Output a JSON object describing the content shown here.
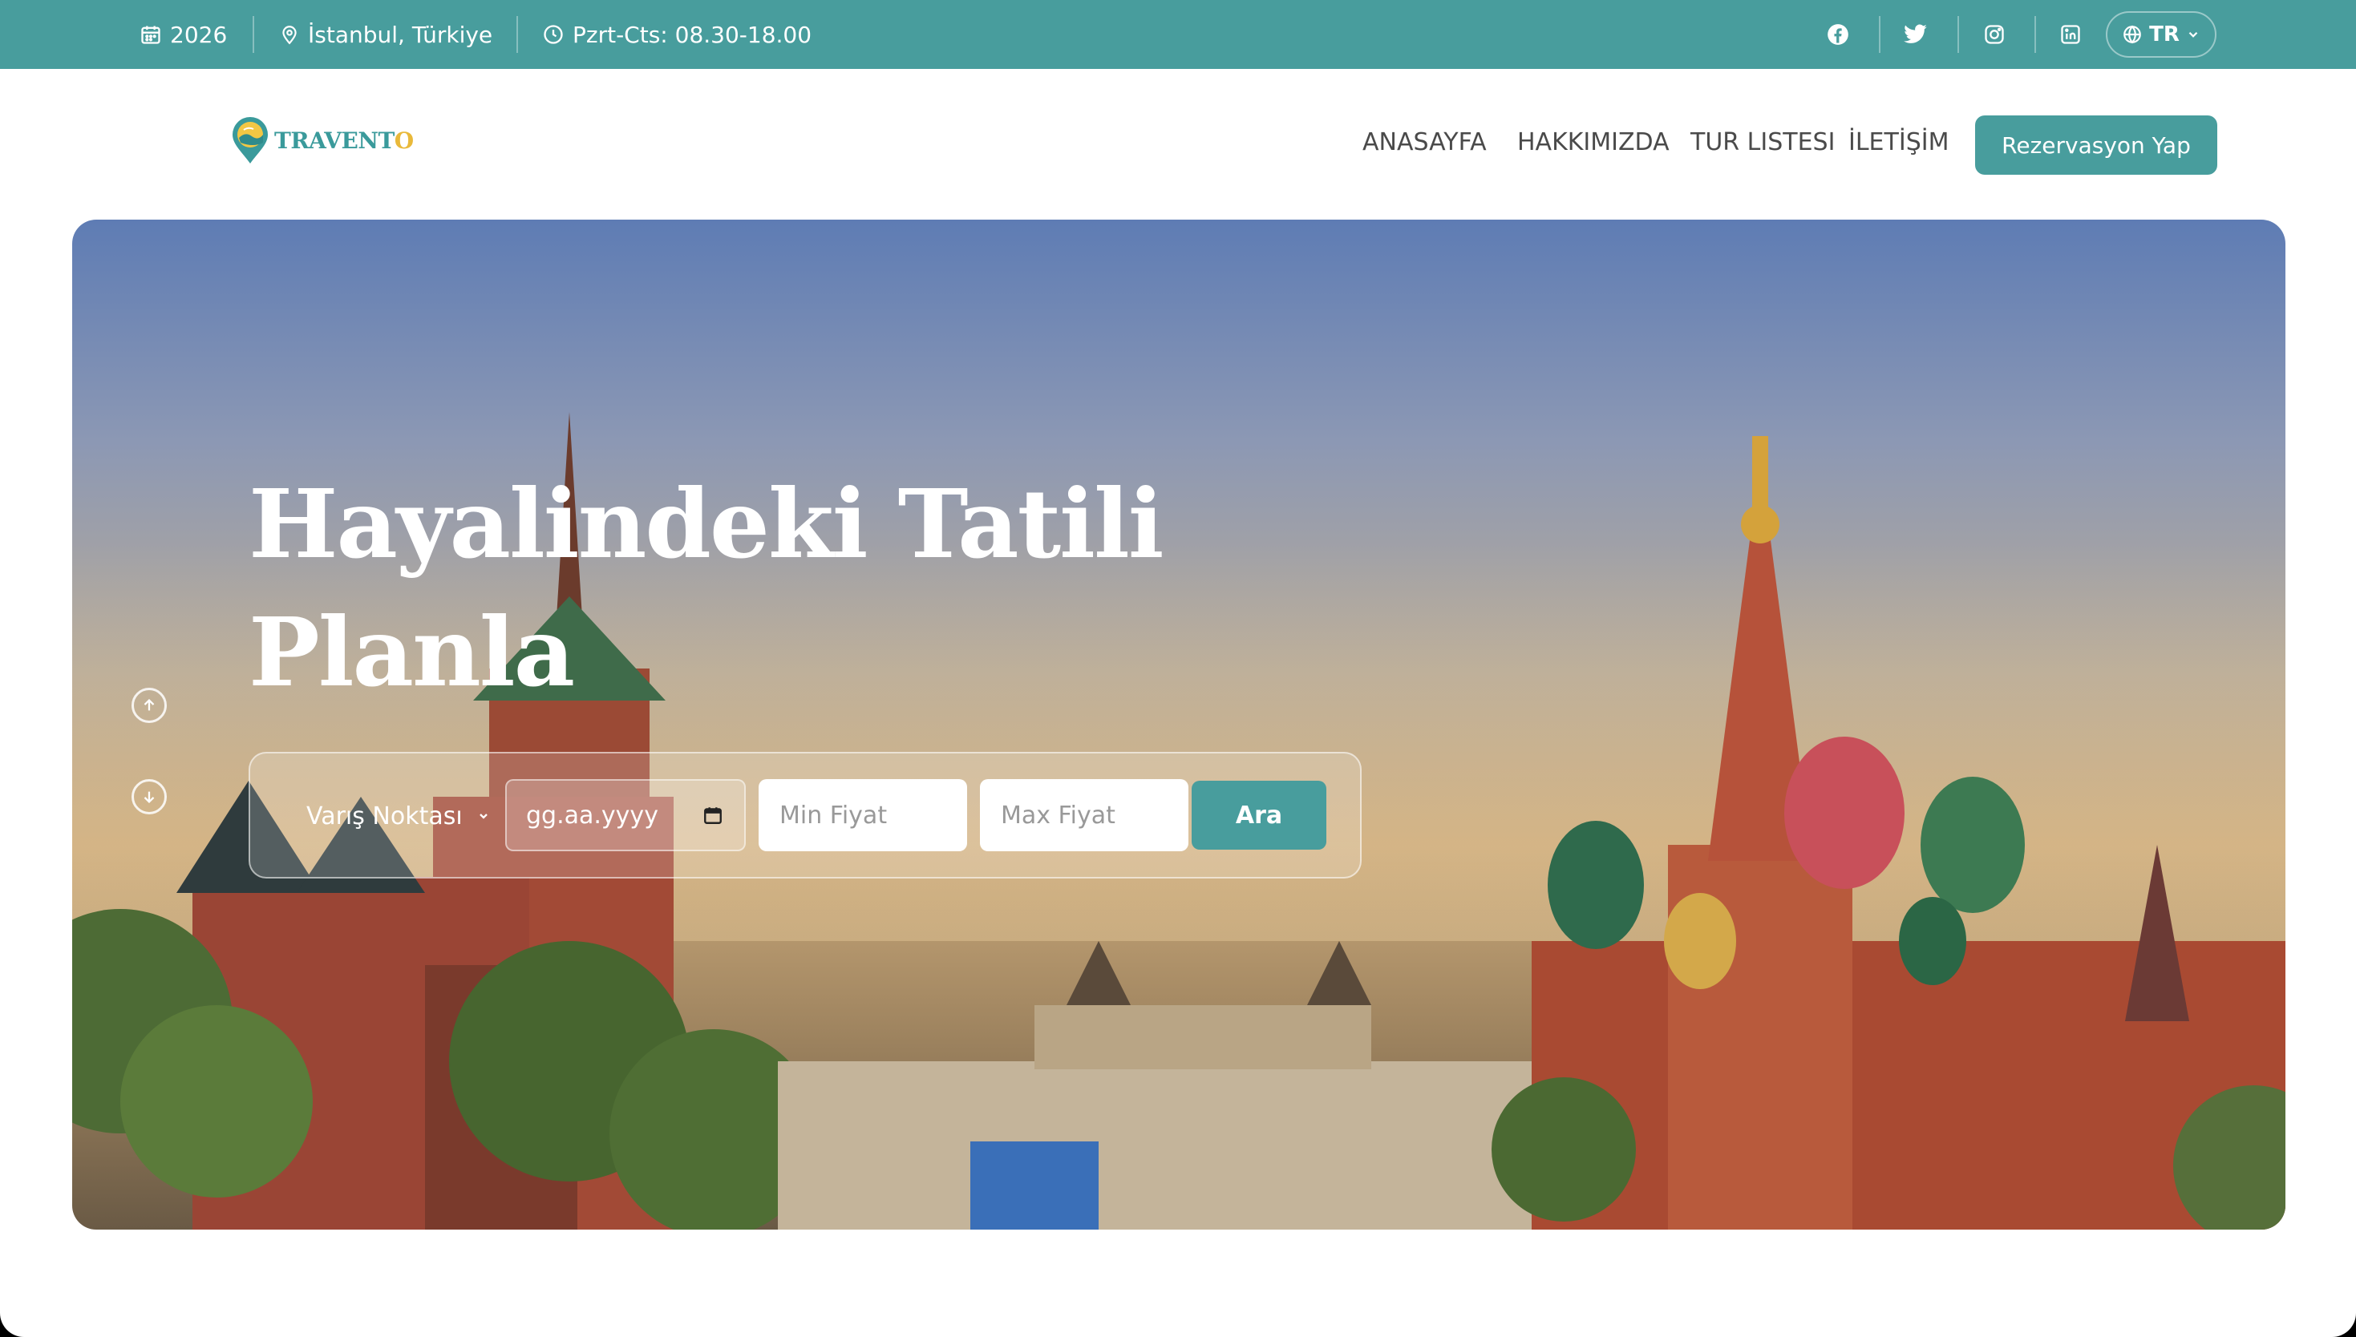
{
  "topbar": {
    "year": "2026",
    "location": "İstanbul, Türkiye",
    "hours": "Pzrt-Cts: 08.30-18.00",
    "social": [
      "facebook-icon",
      "twitter-icon",
      "instagram-icon",
      "linkedin-icon"
    ],
    "language": "TR"
  },
  "header": {
    "logo_main": "TRAVENT",
    "logo_accent": "O",
    "nav": [
      "ANASAYFA",
      "HAKKIMIZDA",
      "TUR LISTESI",
      "İLETİŞİM"
    ],
    "cta": "Rezervasyon Yap"
  },
  "hero": {
    "title_line1": "Hayalindeki Tatili",
    "title_line2": "Planla"
  },
  "search": {
    "destination_label": "Varış Noktası",
    "date_placeholder": "gg.aa.yyyy",
    "min_price_placeholder": "Min Fiyat",
    "max_price_placeholder": "Max Fiyat",
    "submit_label": "Ara"
  },
  "colors": {
    "brand": "#489d9d",
    "accent": "#e9b93a",
    "nav_text": "#4a4a4a"
  }
}
